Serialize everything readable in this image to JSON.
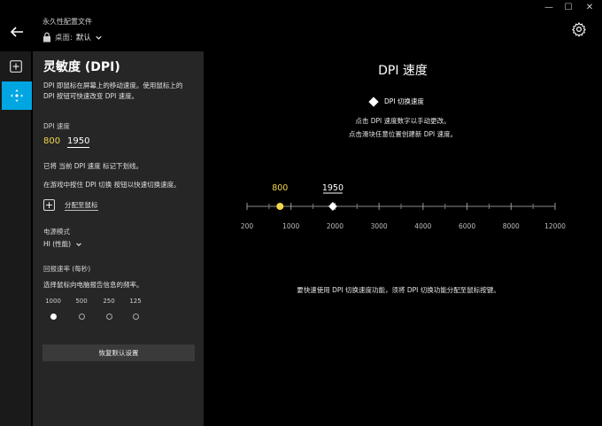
{
  "window": {
    "minimize_glyph": "—",
    "maximize_glyph": "☐",
    "close_glyph": "✕"
  },
  "header": {
    "profile_title": "永久性配置文件",
    "profile_label": "桌面:",
    "profile_value": "默认",
    "icons": [
      "back-arrow-icon",
      "lock-icon",
      "chevron-down-icon",
      "gear-icon"
    ]
  },
  "sidebar": {
    "icons": [
      "add-icon",
      "dpi-sensitivity-icon"
    ]
  },
  "panel": {
    "title": "灵敏度 (DPI)",
    "description": "DPI 即鼠标在屏幕上的移动速度。使用鼠标上的 DPI 按钮可快速改变 DPI 速度。",
    "dpi_label": "DPI 速度",
    "dpi_values": [
      "800",
      "1950"
    ],
    "note_current": "已将 当前 DPI 速度 标记下划线。",
    "note_shift": "在游戏中按住 DPI 切换 按钮以快速切换速度。",
    "assign_label": "分配至鼠标",
    "power_label": "电源模式",
    "power_value": "HI (性能)",
    "report_label": "回报速率 (每秒)",
    "report_desc": "选择鼠标向电脑报告信息的频率。",
    "report_rates": [
      "1000",
      "500",
      "250",
      "125"
    ],
    "report_selected": "1000",
    "reset_label": "恢复默认设置"
  },
  "main": {
    "title": "DPI 速度",
    "legend_label": "DPI 切换速度",
    "hint1": "点击 DPI 速度数字以手动更改。",
    "hint2": "点击滑块任意位置创建新 DPI 速度。",
    "bottom_note": "要快速使用 DPI 切换速度功能，须将 DPI 切换功能分配至鼠标按键。"
  },
  "slider_data": {
    "ticks": [
      "200",
      "1000",
      "2000",
      "3000",
      "4000",
      "6000",
      "8000",
      "12000"
    ],
    "markers": [
      {
        "label": "800",
        "value": 800,
        "style": "current",
        "color": "#f2d64b"
      },
      {
        "label": "1950",
        "value": 1950,
        "style": "shift",
        "color": "#ffffff"
      }
    ]
  },
  "colors": {
    "accent": "#00a6e2",
    "current_dpi": "#f2d64b",
    "panel": "#262626"
  }
}
